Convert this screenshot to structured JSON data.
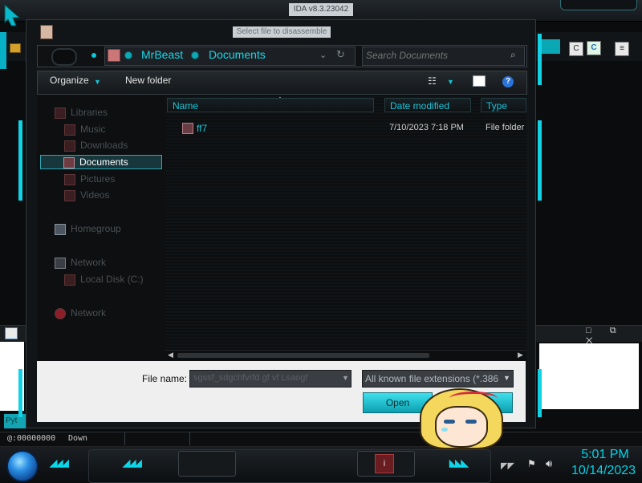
{
  "ida": {
    "title": "IDA v8.3.23042",
    "output_tab": "Pyt",
    "status_address": "@:00000000",
    "status_direction": "Down"
  },
  "dialog": {
    "title": "Select file to disassemble",
    "breadcrumbs": [
      "MrBeast",
      "Documents"
    ],
    "search_placeholder": "Search Documents",
    "toolbar": {
      "organize": "Organize",
      "new_folder": "New folder"
    },
    "nav": {
      "items": [
        {
          "label": "Libraries",
          "dim": true
        },
        {
          "label": "Music",
          "dim": true
        },
        {
          "label": "Downloads",
          "dim": true
        },
        {
          "label": "Documents",
          "selected": true
        },
        {
          "label": "Pictures",
          "dim": true
        },
        {
          "label": "Videos",
          "dim": true
        },
        {
          "label": "Homegroup",
          "dim": true
        },
        {
          "label": "Network",
          "dim": true
        },
        {
          "label": "Local Disk (C:)",
          "dim": true
        },
        {
          "label": "Network",
          "dim": true
        }
      ]
    },
    "columns": [
      "Name",
      "Date modified",
      "Type"
    ],
    "rows": [
      {
        "name": "ff7",
        "date_modified": "7/10/2023 7:18 PM",
        "type": "File folder"
      }
    ],
    "file_name_label": "File name:",
    "file_name_value": "sgssf_sdgchfvrfd gf vf Lsaogf",
    "filter_value": "All known file extensions (*.386",
    "open_label": "Open",
    "cancel_label": ""
  },
  "taskbar": {
    "time": "5:01 PM",
    "date": "10/14/2023"
  },
  "colors": {
    "accent": "#12d2e6",
    "selection_bg": "#17373d"
  }
}
